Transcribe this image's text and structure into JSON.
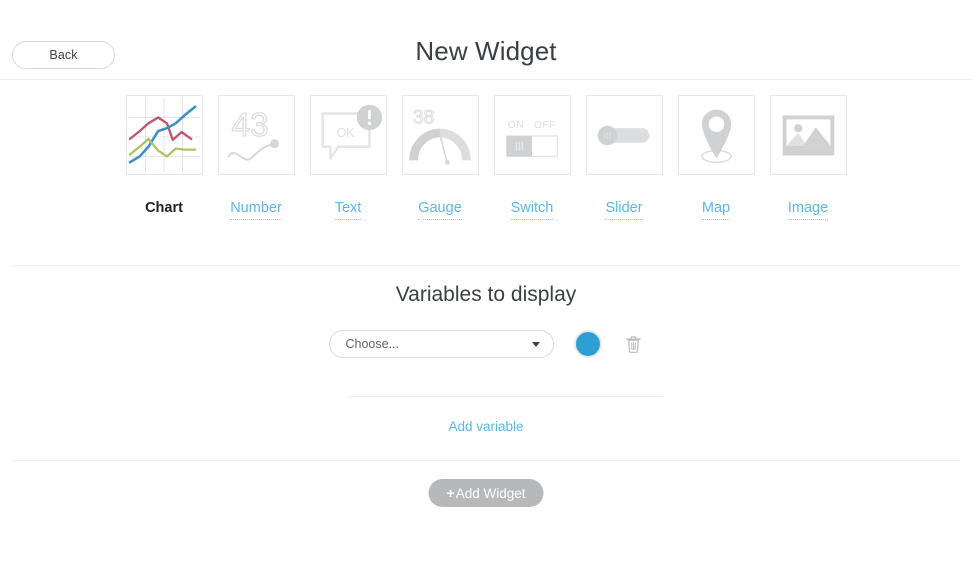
{
  "header": {
    "back_label": "Back",
    "title": "New Widget"
  },
  "widget_types": [
    {
      "label": "Chart",
      "icon": "line-chart-icon",
      "active": true
    },
    {
      "label": "Number",
      "icon": "number-43-icon",
      "active": false
    },
    {
      "label": "Text",
      "icon": "speech-bubble-ok-icon",
      "active": false
    },
    {
      "label": "Gauge",
      "icon": "gauge-38-icon",
      "active": false
    },
    {
      "label": "Switch",
      "icon": "toggle-switch-icon",
      "active": false
    },
    {
      "label": "Slider",
      "icon": "slider-icon",
      "active": false
    },
    {
      "label": "Map",
      "icon": "map-pin-icon",
      "active": false
    },
    {
      "label": "Image",
      "icon": "picture-icon",
      "active": false
    }
  ],
  "icon_text": {
    "number_value": "43",
    "gauge_value": "38",
    "text_ok": "OK",
    "switch_on": "ON",
    "switch_off": "OFF",
    "alert_mark": "!"
  },
  "variables": {
    "section_title": "Variables to display",
    "rows": [
      {
        "select_value": "Choose...",
        "select_placeholder": "Choose...",
        "color": "#2e9fd4",
        "delete_icon": "trash-icon"
      }
    ],
    "add_variable_label": "Add variable"
  },
  "footer": {
    "add_widget_label": "Add Widget",
    "add_widget_plus": "+"
  },
  "colors": {
    "link_blue": "#5bb7e8",
    "swatch_blue": "#2e9fd4",
    "button_gray": "#b6b8ba",
    "divider": "#ededed"
  }
}
